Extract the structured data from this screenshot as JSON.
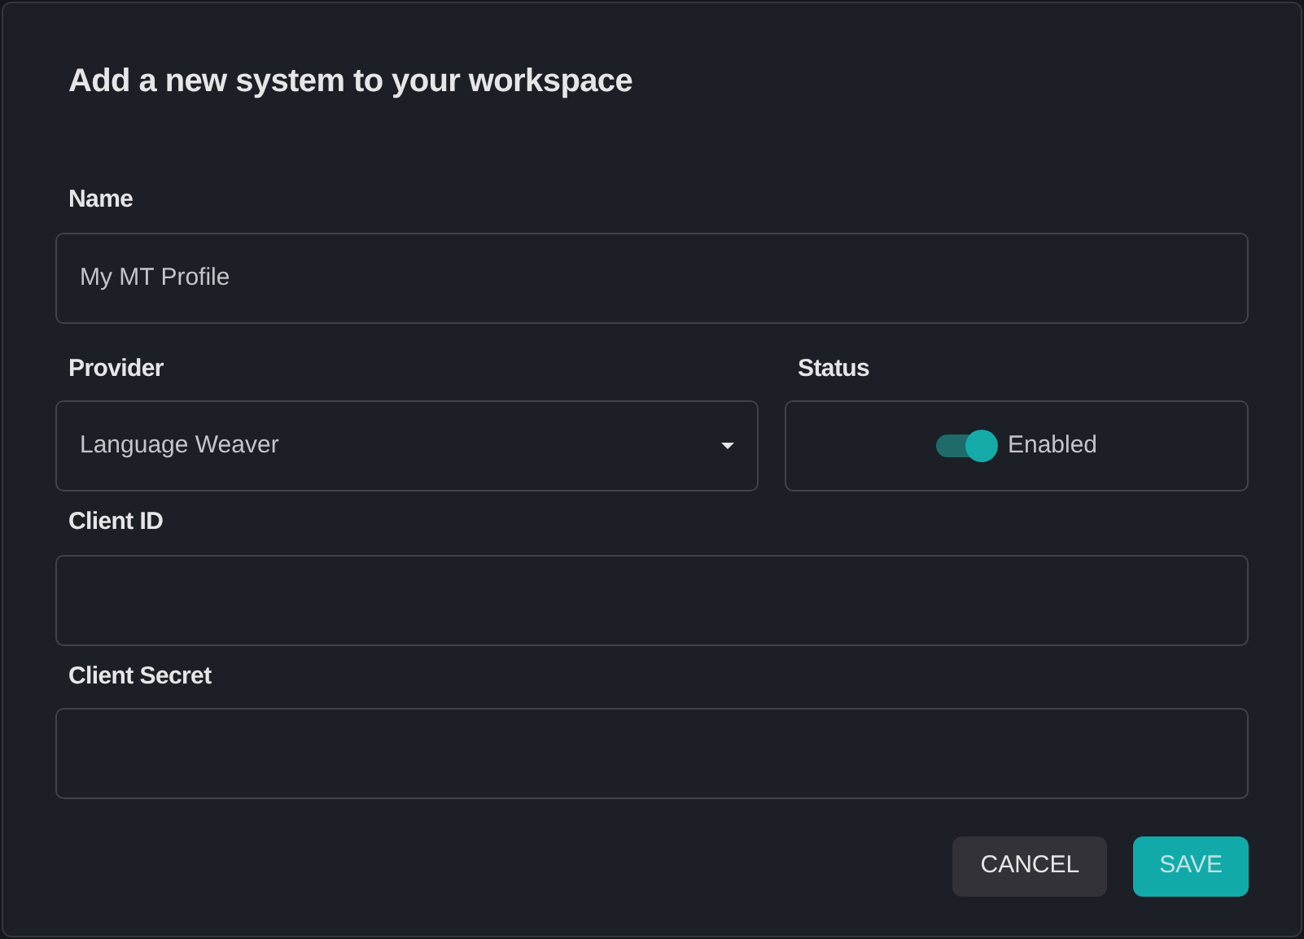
{
  "dialog": {
    "title": "Add a new system to your workspace"
  },
  "fields": [
    {
      "kind": "text",
      "label": "Name",
      "value": "My MT Profile"
    },
    {
      "kind": "select",
      "label": "Provider",
      "value": "Language Weaver"
    },
    {
      "kind": "toggle",
      "label": "Status",
      "value": "Enabled",
      "on": true
    },
    {
      "kind": "text",
      "label": "Client ID"
    },
    {
      "kind": "text",
      "label": "Client Secret"
    }
  ],
  "buttons": [
    {
      "label": "CANCEL",
      "kind": "secondary"
    },
    {
      "label": "SAVE",
      "kind": "primary",
      "disabled": true
    }
  ]
}
